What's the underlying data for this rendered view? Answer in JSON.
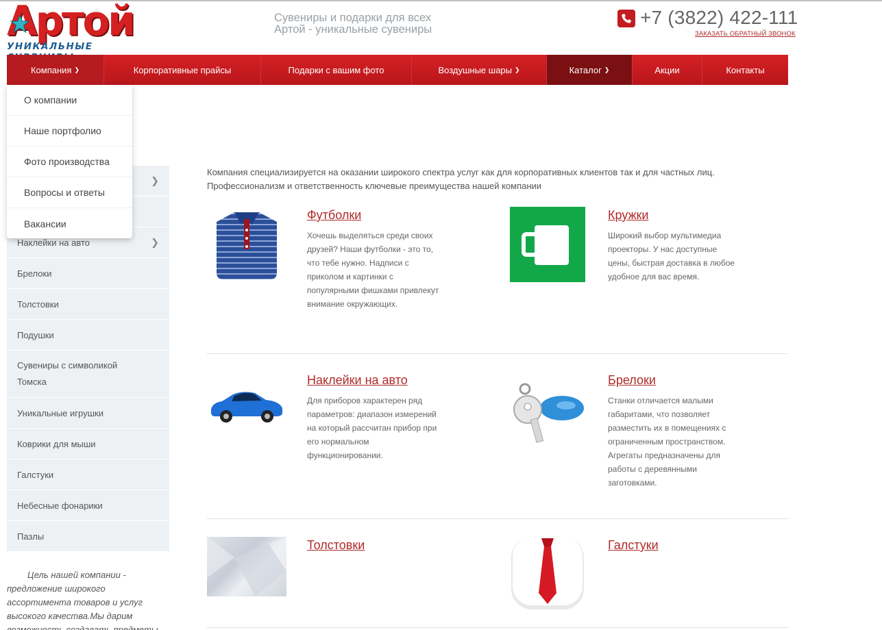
{
  "header": {
    "logo_text": "Артой",
    "logo_sub": "уникальные сувениры",
    "slogan_line1": "Сувениры и подарки для всех",
    "slogan_line2": "Артой - уникальные сувениры",
    "phone": "+7 (3822) 422-111",
    "callback": "ЗАКАЗАТЬ ОБРАТНЫЙ ЗВОНОК"
  },
  "nav": {
    "items": [
      {
        "label": "Компания"
      },
      {
        "label": "Корпоративные прайсы"
      },
      {
        "label": "Подарки с вашим фото"
      },
      {
        "label": "Воздушные шары"
      },
      {
        "label": "Каталог"
      },
      {
        "label": "Акции"
      },
      {
        "label": "Контакты"
      }
    ]
  },
  "dropdown": {
    "items": [
      "О компании",
      "Наше портфолио",
      "Фото производства",
      "Вопросы и ответы",
      "Вакансии"
    ]
  },
  "sidebar": {
    "items": [
      "Наклейки на авто",
      "Брелоки",
      "Толстовки",
      "Подушки",
      "Сувениры с символикой Томска",
      "Уникальные игрушки",
      "Коврики для мыши",
      "Галстуки",
      "Небесные фонарики",
      "Пазлы"
    ],
    "text": "Цель нашей компании - предложение широкого ассортимента товаров и услуг высокого качества.Мы дарим возможность создавать предметы"
  },
  "main": {
    "intro_line1": "Компания специализируется на оказании широкого спектра услуг как для корпоративных клиентов так и для частных лиц.",
    "intro_line2": "Профессионализм и ответственность ключевые преимущества нашей компании",
    "cards": [
      {
        "title": "Футболки",
        "desc": "Хочешь выделяться среди своих друзей? Наши футболки - это то, что тебе нужно. Надписи с приколом и картинки с популярными фишками привлекут внимание окружающих."
      },
      {
        "title": "Кружки",
        "desc": "Широкий выбор мультимедиа проекторы. У нас доступные цены, быстрая доставка в любое удобное для вас время."
      },
      {
        "title": "Наклейки на авто",
        "desc": "Для приборов характерен ряд параметров: диапазон измерений на который рассчитан прибор при его нормальном функционировании."
      },
      {
        "title": "Брелоки",
        "desc": "Станки отличается малыми габаритами, что позволяет разместить их в помещениях с ограниченным пространством. Агрегаты предназначены для работы с деревянными заготовками."
      },
      {
        "title": "Толстовки",
        "desc": ""
      },
      {
        "title": "Галстуки",
        "desc": ""
      }
    ]
  },
  "colors": {
    "brand_red": "#c21d22",
    "link_red": "#b02a2a",
    "mug_green": "#12a84a",
    "sidebar_bg": "#edf1f4"
  }
}
